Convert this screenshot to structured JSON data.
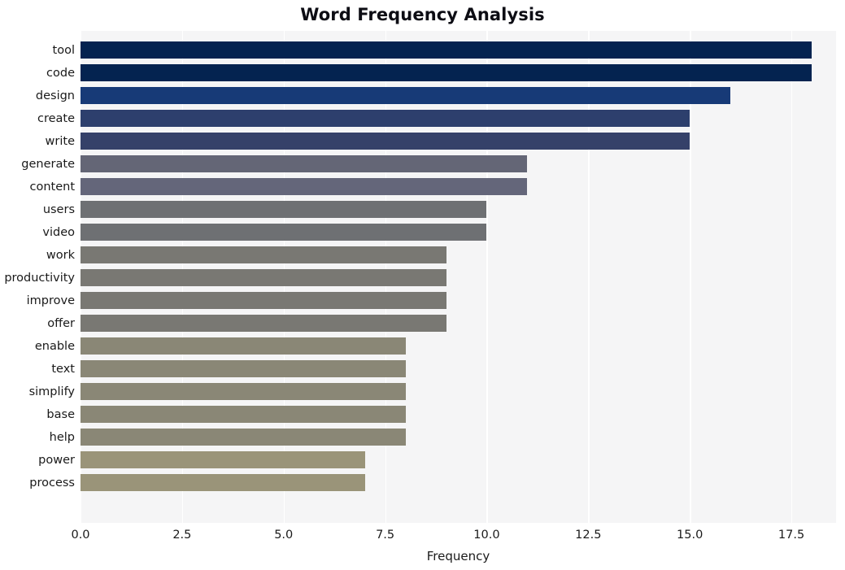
{
  "chart_data": {
    "type": "bar",
    "orientation": "horizontal",
    "title": "Word Frequency Analysis",
    "xlabel": "Frequency",
    "ylabel": "",
    "categories": [
      "tool",
      "code",
      "design",
      "create",
      "write",
      "generate",
      "content",
      "users",
      "video",
      "work",
      "productivity",
      "improve",
      "offer",
      "enable",
      "text",
      "simplify",
      "base",
      "help",
      "power",
      "process"
    ],
    "values": [
      18,
      18,
      16,
      15,
      15,
      11,
      11,
      10,
      10,
      9,
      9,
      9,
      9,
      8,
      8,
      8,
      8,
      8,
      7,
      7
    ],
    "bar_colors": [
      "#042350",
      "#042350",
      "#173a77",
      "#2d3f6d",
      "#354169",
      "#646676",
      "#64667a",
      "#6e7073",
      "#6e7073",
      "#797873",
      "#797873",
      "#797873",
      "#797873",
      "#8a8776",
      "#8a8776",
      "#8a8776",
      "#8a8776",
      "#8a8776",
      "#9a9479",
      "#9a9479"
    ],
    "xlim": [
      0,
      18.6
    ],
    "x_ticks": [
      0.0,
      2.5,
      5.0,
      7.5,
      10.0,
      12.5,
      15.0,
      17.5
    ],
    "x_tick_labels": [
      "0.0",
      "2.5",
      "5.0",
      "7.5",
      "10.0",
      "12.5",
      "15.0",
      "17.5"
    ],
    "grid": true,
    "grid_color": "#ffffff",
    "plot_background": "#f5f5f6",
    "figure_background": "#ffffff",
    "legend": null
  }
}
